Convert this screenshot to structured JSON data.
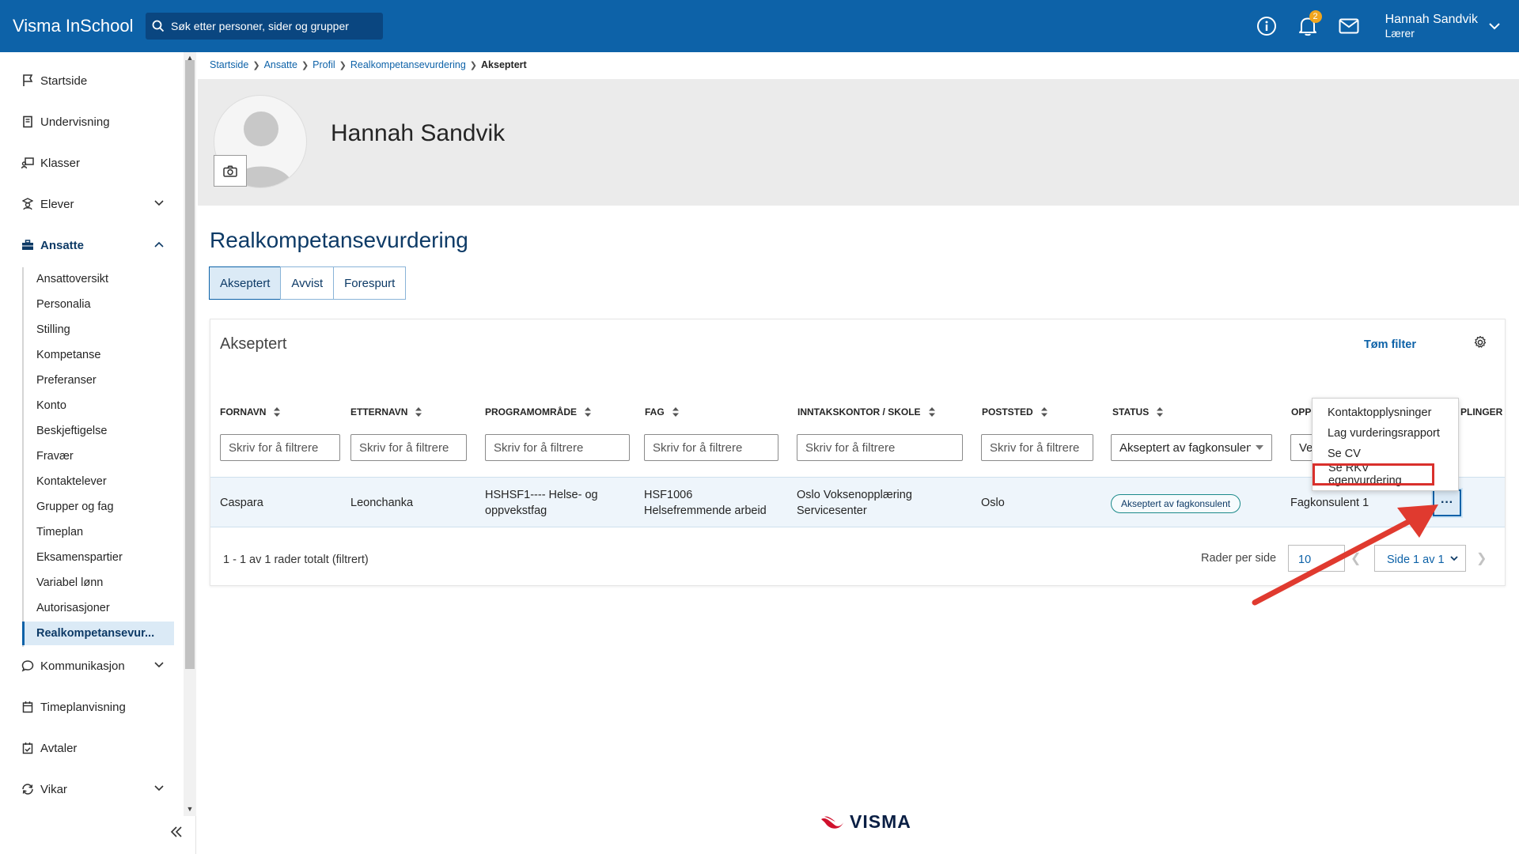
{
  "app": {
    "title": "Visma InSchool"
  },
  "search": {
    "placeholder": "Søk etter personer, sider og grupper"
  },
  "notifications": {
    "count": "2"
  },
  "user": {
    "name": "Hannah Sandvik",
    "role": "Lærer"
  },
  "sidebar": {
    "items": [
      {
        "label": "Startside",
        "icon": "flag-icon"
      },
      {
        "label": "Undervisning",
        "icon": "book-icon"
      },
      {
        "label": "Klasser",
        "icon": "classroom-icon"
      },
      {
        "label": "Elever",
        "icon": "students-icon"
      },
      {
        "label": "Ansatte",
        "icon": "briefcase-icon"
      }
    ],
    "ansatte_sub": [
      "Ansattoversikt",
      "Personalia",
      "Stilling",
      "Kompetanse",
      "Preferanser",
      "Konto",
      "Beskjeftigelse",
      "Fravær",
      "Kontaktelever",
      "Grupper og fag",
      "Timeplan",
      "Eksamenspartier",
      "Variabel lønn",
      "Autorisasjoner",
      "Realkompetansevur..."
    ],
    "lower_items": [
      {
        "label": "Kommunikasjon",
        "icon": "chat-icon"
      },
      {
        "label": "Timeplanvisning",
        "icon": "calendar-icon"
      },
      {
        "label": "Avtaler",
        "icon": "calendar-check-icon"
      },
      {
        "label": "Vikar",
        "icon": "refresh-icon"
      }
    ]
  },
  "breadcrumb": {
    "items": [
      "Startside",
      "Ansatte",
      "Profil",
      "Realkompetansevurdering"
    ],
    "current": "Akseptert"
  },
  "profile": {
    "name": "Hannah Sandvik"
  },
  "page": {
    "title": "Realkompetansevurdering"
  },
  "tabs": [
    "Akseptert",
    "Avvist",
    "Forespurt"
  ],
  "card": {
    "title": "Akseptert",
    "clear_filter": "Tøm filter"
  },
  "table": {
    "columns": [
      "FORNAVN",
      "ETTERNAVN",
      "PROGRAMOMRÅDE",
      "FAG",
      "INNTAKSKONTOR / SKOLE",
      "POSTSTED",
      "STATUS",
      "OPP",
      "PLINGER"
    ],
    "filter_placeholder": "Skriv for å filtrere",
    "status_filter_value": "Akseptert av fagkonsulent",
    "oppf_filter_value": "Ve",
    "row": {
      "fornavn": "Caspara",
      "etternavn": "Leonchanka",
      "programomrade_1": "HSHSF1---- Helse- og",
      "programomrade_2": "oppvekstfag",
      "fag_1": "HSF1006",
      "fag_2": "Helsefremmende arbeid",
      "skole_1": "Oslo Voksenopplæring",
      "skole_2": "Servicesenter",
      "poststed": "Oslo",
      "status": "Akseptert av fagkonsulent",
      "opp": "Fagkonsulent 1",
      "more": "···"
    }
  },
  "footer": {
    "summary": "1 - 1 av 1 rader totalt (filtrert)",
    "rows_label": "Rader per side",
    "rows_value": "10",
    "page_label": "Side 1 av 1"
  },
  "dropdown": [
    "Kontaktopplysninger",
    "Lag vurderingsrapport",
    "Se CV",
    "Se RKV egenvurdering"
  ],
  "logo": {
    "text": "VISMA"
  },
  "colors": {
    "brand": "#0d62a8",
    "accent_red": "#d9302c",
    "highlight_blue": "#dbeaf6"
  }
}
